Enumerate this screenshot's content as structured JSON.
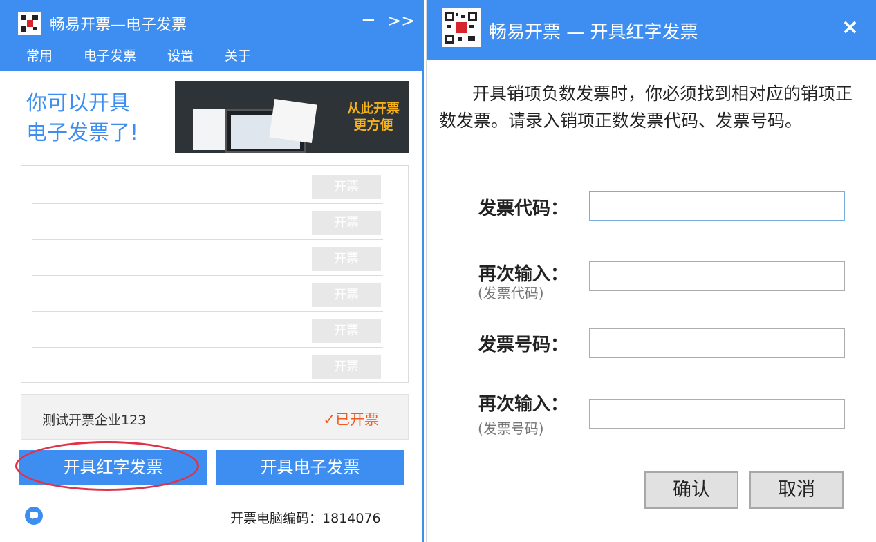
{
  "left_window": {
    "title": "畅易开票—电子发票",
    "minimize_label": "−",
    "expand_label": ">>",
    "menu": [
      "常用",
      "电子发票",
      "设置",
      "关于"
    ],
    "promo_line1": "你可以开具",
    "promo_line2": "电子发票了!",
    "banner_tagline_line1": "从此开票",
    "banner_tagline_line2": "更方便",
    "list_rows": [
      {
        "button_label": "开票"
      },
      {
        "button_label": "开票"
      },
      {
        "button_label": "开票"
      },
      {
        "button_label": "开票"
      },
      {
        "button_label": "开票"
      },
      {
        "button_label": "开票"
      }
    ],
    "company_name": "测试开票企业123",
    "issued_status": "✓已开票",
    "red_invoice_button": "开具红字发票",
    "electronic_invoice_button": "开具电子发票",
    "machine_code_label": "开票电脑编码：1814076"
  },
  "right_window": {
    "title": "畅易开票 — 开具红字发票",
    "close_label": "×",
    "notice": "开具销项负数发票时，你必须找到相对应的销项正数发票。请录入销项正数发票代码、发票号码。",
    "invoice_code_label": "发票代码：",
    "invoice_code_confirm_label": "再次输入：",
    "invoice_code_confirm_hint": "(发票代码)",
    "invoice_number_label": "发票号码：",
    "invoice_number_confirm_label": "再次输入：",
    "invoice_number_confirm_hint": "(发票号码)",
    "invoice_code_value": "",
    "invoice_code_confirm_value": "",
    "invoice_number_value": "",
    "invoice_number_confirm_value": "",
    "confirm_button": "确认",
    "cancel_button": "取消"
  },
  "colors": {
    "brand_blue": "#3d8ef0",
    "status_orange": "#ef5a22",
    "highlight_red": "#e0334a"
  }
}
